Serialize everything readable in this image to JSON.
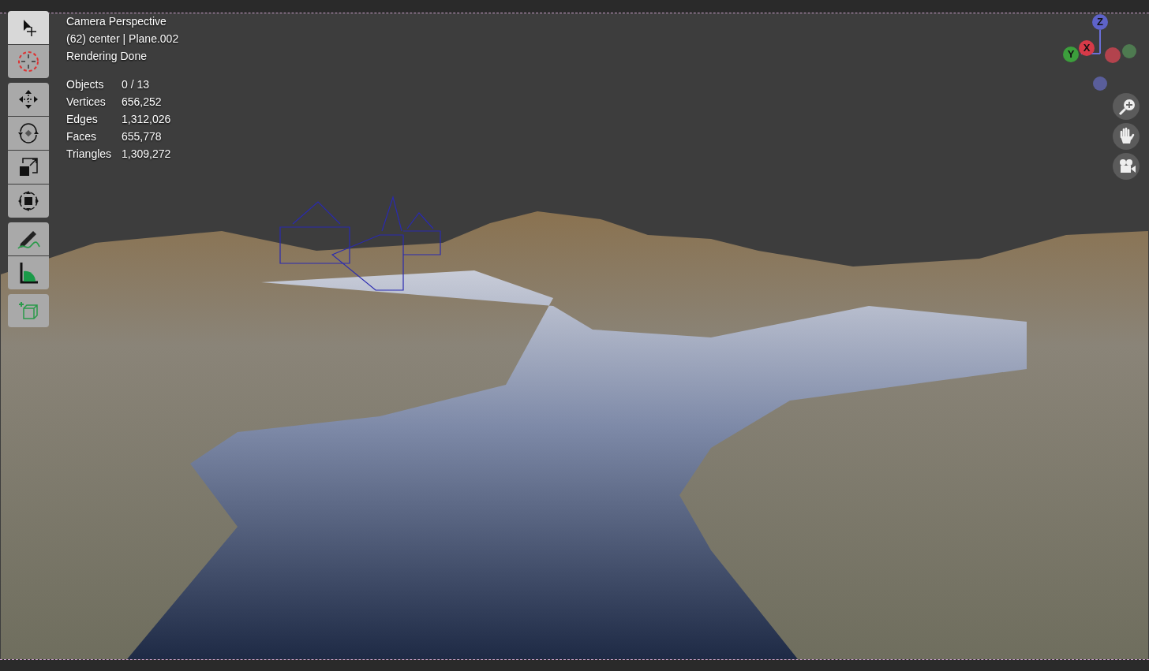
{
  "viewport": {
    "overlay": [
      "Camera Perspective",
      "(62) center | Plane.002",
      "Rendering Done"
    ],
    "stats": [
      {
        "label": "Objects",
        "value": "0 / 13"
      },
      {
        "label": "Vertices",
        "value": "656,252"
      },
      {
        "label": "Edges",
        "value": "1,312,026"
      },
      {
        "label": "Faces",
        "value": "655,778"
      },
      {
        "label": "Triangles",
        "value": "1,309,272"
      }
    ]
  },
  "toolbar": [
    [
      {
        "kind": "select",
        "selected": true
      },
      {
        "kind": "cursor",
        "selected": false
      }
    ],
    [
      {
        "kind": "move",
        "selected": false
      },
      {
        "kind": "rotate",
        "selected": false
      },
      {
        "kind": "scale",
        "selected": false
      },
      {
        "kind": "transform",
        "selected": false
      }
    ],
    [
      {
        "kind": "annotate",
        "selected": false
      },
      {
        "kind": "measure",
        "selected": false
      }
    ],
    [
      {
        "kind": "add-cube",
        "selected": false
      }
    ]
  ],
  "gizmo": {
    "axes": [
      {
        "label": "Z",
        "color": "#5e63c9"
      },
      {
        "label": "X",
        "color": "#d63a48"
      },
      {
        "label": "Y",
        "color": "#3c9e3c"
      }
    ]
  },
  "nav_buttons": [
    {
      "kind": "zoom"
    },
    {
      "kind": "pan"
    },
    {
      "kind": "camera"
    }
  ]
}
